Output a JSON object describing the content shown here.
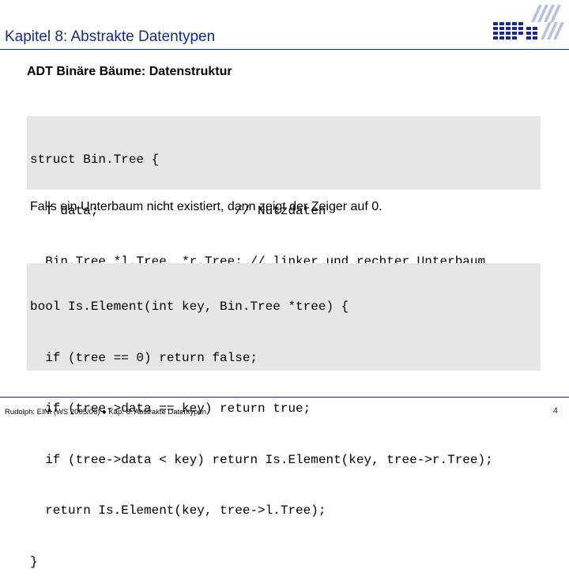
{
  "header": {
    "title": "Kapitel 8: Abstrakte Datentypen"
  },
  "slide": {
    "subtitle": "ADT Binäre Bäume: Datenstruktur",
    "code_block_1": [
      "struct Bin.Tree {",
      "  T data;                  // Nutzdaten",
      "  Bin.Tree *l.Tree, *r.Tree; // linker und rechter Unterbaum",
      "};"
    ],
    "note": "Falls ein Unterbaum nicht existiert, dann zeigt der Zeiger auf 0.",
    "code_block_2": [
      "bool Is.Element(int key, Bin.Tree *tree) {",
      "  if (tree == 0) return false;",
      "  if (tree->data == key) return true;",
      "  if (tree->data < key) return Is.Element(key, tree->r.Tree);",
      "  return Is.Element(key, tree->l.Tree);",
      "}"
    ]
  },
  "footer": {
    "text": "Rudolph: EINI (WS 2005/06) ● Kap. 8: Abstrakte Datentypen",
    "page_number": "4"
  },
  "colors": {
    "accent": "#1b2a8a",
    "code_background": "#e6e6e6"
  }
}
